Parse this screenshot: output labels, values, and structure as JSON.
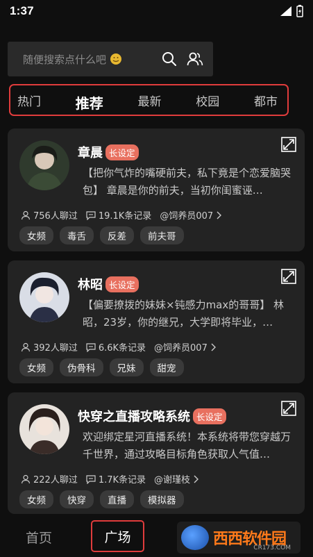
{
  "status_bar": {
    "time": "1:37"
  },
  "search": {
    "placeholder": "随便搜索点什么吧"
  },
  "tabs": [
    {
      "label": "热门",
      "active": false
    },
    {
      "label": "推荐",
      "active": true
    },
    {
      "label": "最新",
      "active": false
    },
    {
      "label": "校园",
      "active": false
    },
    {
      "label": "都市",
      "active": false
    }
  ],
  "cards": [
    {
      "title": "章晨",
      "badge": "长设定",
      "description": "【把你气炸的嘴硬前夫，私下竟是个恋爱脑哭包】 章晨是你的前夫，当初你闺蜜诬…",
      "chats": "756人聊过",
      "records": "19.1K条记录",
      "author": "@饲养员007",
      "tags": [
        "女频",
        "毒舌",
        "反差",
        "前夫哥"
      ]
    },
    {
      "title": "林昭",
      "badge": "长设定",
      "description": "【偏要撩拨的妹妹×钝感力max的哥哥】 林昭，23岁，你的继兄，大学即将毕业，…",
      "chats": "392人聊过",
      "records": "6.6K条记录",
      "author": "@饲养员007",
      "tags": [
        "女频",
        "伪骨科",
        "兄妹",
        "甜宠"
      ]
    },
    {
      "title": "快穿之直播攻略系统",
      "badge": "长设定",
      "description": "欢迎绑定星河直播系统！本系统将带您穿越万千世界，通过攻略目标角色获取人气值…",
      "chats": "222人聊过",
      "records": "1.7K条记录",
      "author": "@谢瑾枝",
      "tags": [
        "女频",
        "快穿",
        "直播",
        "模拟器"
      ]
    }
  ],
  "bottom_nav": {
    "home": "首页",
    "plaza": "广场"
  },
  "watermark": {
    "text": "西西软件园",
    "sub": "CR173.COM"
  },
  "colors": {
    "accent_red": "#e03c3c",
    "badge": "#e8705f",
    "card_bg": "#232323",
    "page_bg": "#0f0f0f"
  }
}
